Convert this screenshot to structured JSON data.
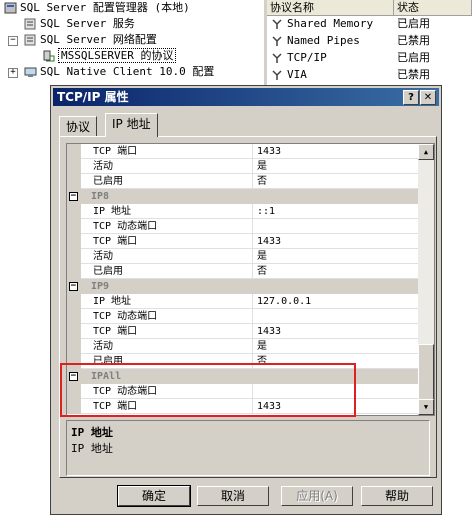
{
  "tree": {
    "items": [
      {
        "label": "SQL Server 配置管理器 (本地)"
      },
      {
        "label": "SQL Server 服务"
      },
      {
        "label": "SQL Server 网络配置"
      },
      {
        "label": "MSSQLSERVER 的协议"
      },
      {
        "label": "SQL Native Client 10.0 配置"
      }
    ]
  },
  "protocols": {
    "headers": [
      "协议名称",
      "状态"
    ],
    "rows": [
      {
        "name": "Shared Memory",
        "status": "已启用"
      },
      {
        "name": "Named Pipes",
        "status": "已禁用"
      },
      {
        "name": "TCP/IP",
        "status": "已启用"
      },
      {
        "name": "VIA",
        "status": "已禁用"
      }
    ]
  },
  "dialog": {
    "title": "TCP/IP 属性",
    "help_btn": "?",
    "close_btn": "✕",
    "tabs": [
      "协议",
      "IP 地址"
    ],
    "grid": {
      "r0": {
        "name": "TCP 端口",
        "value": "1433"
      },
      "r1": {
        "name": "活动",
        "value": "是"
      },
      "r2": {
        "name": "已启用",
        "value": "否"
      },
      "c1": {
        "name": "IP8"
      },
      "r3": {
        "name": "IP 地址",
        "value": "::1"
      },
      "r4": {
        "name": "TCP 动态端口",
        "value": ""
      },
      "r5": {
        "name": "TCP 端口",
        "value": "1433"
      },
      "r6": {
        "name": "活动",
        "value": "是"
      },
      "r7": {
        "name": "已启用",
        "value": "否"
      },
      "c2": {
        "name": "IP9"
      },
      "r8": {
        "name": "IP 地址",
        "value": "127.0.0.1"
      },
      "r9": {
        "name": "TCP 动态端口",
        "value": ""
      },
      "r10": {
        "name": "TCP 端口",
        "value": "1433"
      },
      "r11": {
        "name": "活动",
        "value": "是"
      },
      "r12": {
        "name": "已启用",
        "value": "否"
      },
      "c3": {
        "name": "IPAll"
      },
      "r13": {
        "name": "TCP 动态端口",
        "value": ""
      },
      "r14": {
        "name": "TCP 端口",
        "value": "1433"
      }
    },
    "description": {
      "title": "IP 地址",
      "text": "IP 地址"
    },
    "buttons": {
      "ok": "确定",
      "cancel": "取消",
      "apply": "应用(A)",
      "help": "帮助"
    }
  }
}
